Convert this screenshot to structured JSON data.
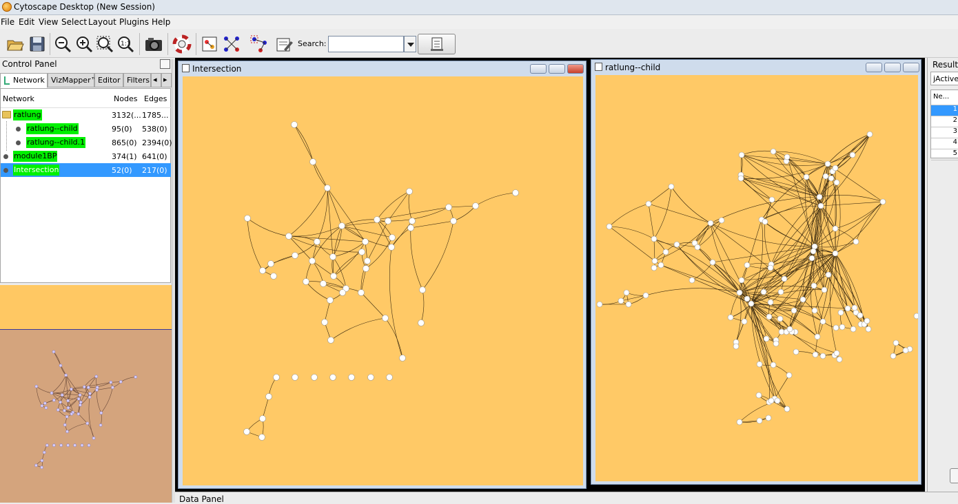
{
  "window": {
    "title": "Cytoscape Desktop (New Session)"
  },
  "menu": [
    "File",
    "Edit",
    "View",
    "Select",
    "Layout",
    "Plugins",
    "Help"
  ],
  "toolbar": {
    "search_label": "Search:",
    "search_value": ""
  },
  "control_panel": {
    "title": "Control Panel",
    "tabs": [
      "Network",
      "VizMapper™",
      "Editor",
      "Filters"
    ],
    "columns": {
      "network": "Network",
      "nodes": "Nodes",
      "edges": "Edges"
    },
    "rows": [
      {
        "name": "ratlung",
        "nodes": "3132(...",
        "edges": "1785..."
      },
      {
        "name": "ratlung--child",
        "nodes": "95(0)",
        "edges": "538(0)"
      },
      {
        "name": "ratlung--child.1",
        "nodes": "865(0)",
        "edges": "2394(0)"
      },
      {
        "name": "module1BP",
        "nodes": "374(1)",
        "edges": "641(0)"
      },
      {
        "name": "Intersection",
        "nodes": "52(0)",
        "edges": "217(0)"
      }
    ]
  },
  "windows": {
    "intersection": {
      "title": "Intersection"
    },
    "child": {
      "title": "ratlung--child"
    }
  },
  "results": {
    "title": "Results",
    "tab": "jActiveModules",
    "column": "Ne...",
    "rows": [
      "1",
      "2",
      "3",
      "4",
      "5"
    ]
  },
  "data_panel": {
    "title": "Data Panel"
  },
  "colors": {
    "canvas": "#ffc966",
    "selection": "#3399ff",
    "highlight": "#00f000",
    "overview": "#d4a47d"
  },
  "icons": [
    "open-folder-icon",
    "save-icon",
    "zoom-out-icon",
    "zoom-in-icon",
    "zoom-selected-icon",
    "zoom-fit-icon",
    "camera-icon",
    "lifebuoy-icon",
    "new-network-icon",
    "layout-icon",
    "layout-selected-icon",
    "edit-icon",
    "search-go-icon"
  ]
}
